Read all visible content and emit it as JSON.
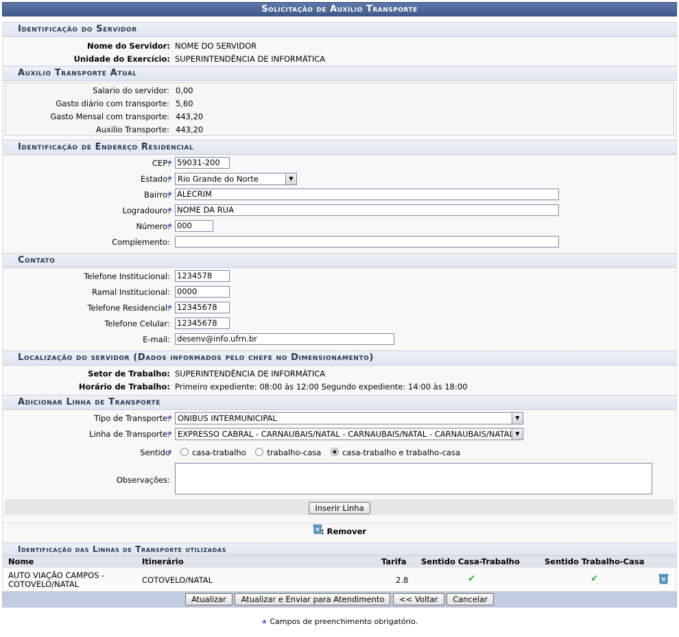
{
  "title": "Solicitação de Auxílio Transporte",
  "sections": {
    "identificacao": {
      "heading": "Identificação do Servidor",
      "fields": [
        {
          "label": "Nome do Servidor:",
          "value": "NOME DO SERVIDOR"
        },
        {
          "label": "Unidade do Exercício:",
          "value": "SUPERINTENDÊNCIA DE INFORMÁTICA"
        }
      ]
    },
    "auxilio": {
      "heading": "Auxilio Transporte Atual",
      "fields": [
        {
          "label": "Salario do servidor:",
          "value": "0,00"
        },
        {
          "label": "Gasto diário com transporte:",
          "value": "5,60"
        },
        {
          "label": "Gasto Mensal com transporte:",
          "value": "443,20"
        },
        {
          "label": "Auxilio Transporte:",
          "value": "443,20"
        }
      ]
    },
    "endereco": {
      "heading": "Identificação de Endereço Residencial",
      "cep_label": "CEP:",
      "cep": "59031-200",
      "estado_label": "Estado:",
      "estado": "Rio Grande do Norte",
      "bairro_label": "Bairro:",
      "bairro": "ALECRIM",
      "logradouro_label": "Logradouro:",
      "logradouro": "NOME DA RUA",
      "numero_label": "Número:",
      "numero": "000",
      "complemento_label": "Complemento:",
      "complemento": ""
    },
    "contato": {
      "heading": "Contato",
      "tel_inst_label": "Telefone Institucional:",
      "tel_inst": "1234578",
      "ramal_label": "Ramal Institucional:",
      "ramal": "0000",
      "tel_res_label": "Telefone Residencial:",
      "tel_res": "12345678",
      "tel_cel_label": "Telefone Celular:",
      "tel_cel": "12345678",
      "email_label": "E-mail:",
      "email": "desenv@info.ufrn.br"
    },
    "localizacao": {
      "heading": "Localização do servidor (Dados informados pelo chefe no Dimensionamento)",
      "setor_label": "Setor de Trabalho:",
      "setor": "SUPERINTENDÊNCIA DE INFORMÁTICA",
      "horario_label": "Horário de Trabalho:",
      "horario": "Primeiro expediente: 08:00 às 12:00 Segundo expediente: 14:00 às 18:00"
    },
    "linha": {
      "heading": "Adicionar Linha de Transporte",
      "tipo_label": "Tipo de Transporte:",
      "tipo": "ONIBUS INTERMUNICIPAL",
      "linha_label": "Linha de Transporte:",
      "linha": "EXPRESSO CABRAL - CARNAUBAIS/NATAL - CARNAUBAIS/NATAL - CARNAUBAIS/NATAL",
      "sentido_label": "Sentido",
      "sentido_options": [
        "casa-trabalho",
        "trabalho-casa",
        "casa-trabalho e trabalho-casa"
      ],
      "sentido_selected": 2,
      "obs_label": "Observações:",
      "obs": "",
      "inserir_label": "Inserir Linha"
    },
    "legend": {
      "remover": ": Remover"
    },
    "tabela": {
      "heading": "Identificação das Linhas de Transporte utilizadas",
      "headers": [
        "Nome",
        "Itinerário",
        "Tarifa",
        "Sentido Casa-Trabalho",
        "Sentido Trabalho-Casa"
      ],
      "rows": [
        {
          "nome_l1": "AUTO VIAÇÃO CAMPOS -",
          "nome_l2": "COTOVELO/NATAL",
          "itinerario": "COTOVELO/NATAL",
          "tarifa": "2.8",
          "casa_trabalho": "✔",
          "trabalho_casa": "✔"
        }
      ]
    }
  },
  "buttons": {
    "atualizar": "Atualizar",
    "enviar": "Atualizar e Enviar para Atendimento",
    "voltar": "<< Voltar",
    "cancelar": "Cancelar"
  },
  "footnote": "Campos de preenchimento obrigatório.",
  "colors": {
    "title_bar": "#4a6698",
    "required_star": "#3d68c4",
    "check": "#3db33d"
  }
}
